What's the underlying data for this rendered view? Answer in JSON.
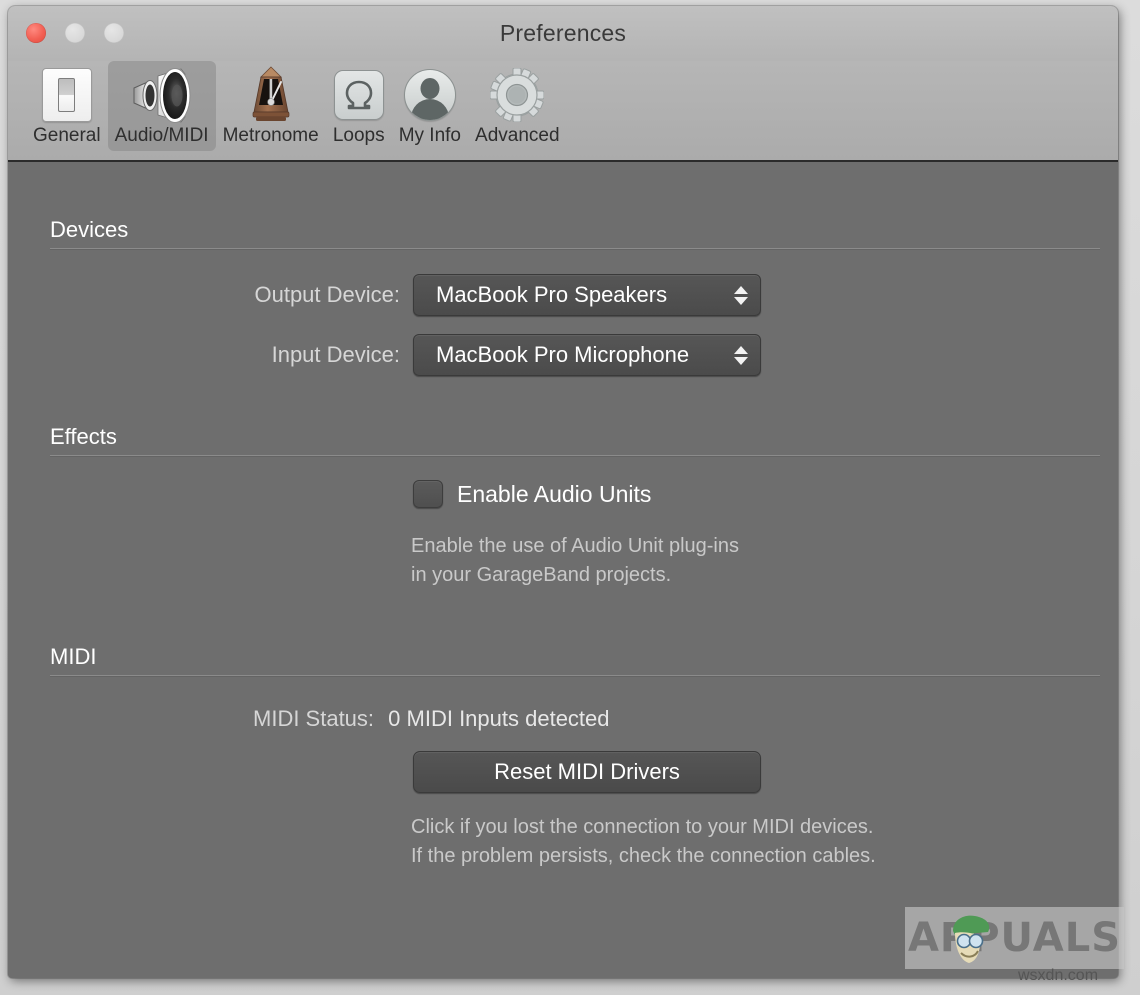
{
  "window": {
    "title": "Preferences",
    "traffic_lights": [
      "close",
      "minimize",
      "zoom"
    ]
  },
  "toolbar": {
    "items": [
      {
        "label": "General",
        "icon": "toggle-switch-icon",
        "selected": false
      },
      {
        "label": "Audio/MIDI",
        "icon": "speaker-icon",
        "selected": true
      },
      {
        "label": "Metronome",
        "icon": "metronome-icon",
        "selected": false
      },
      {
        "label": "Loops",
        "icon": "loops-icon",
        "selected": false
      },
      {
        "label": "My Info",
        "icon": "person-icon",
        "selected": false
      },
      {
        "label": "Advanced",
        "icon": "gear-icon",
        "selected": false
      }
    ]
  },
  "devices": {
    "heading": "Devices",
    "output_label": "Output Device:",
    "output_value": "MacBook Pro Speakers",
    "input_label": "Input Device:",
    "input_value": "MacBook Pro Microphone"
  },
  "effects": {
    "heading": "Effects",
    "checkbox_label": "Enable Audio Units",
    "checked": false,
    "help": "Enable the use of Audio Unit plug-ins\nin your GarageBand projects."
  },
  "midi": {
    "heading": "MIDI",
    "status_label": "MIDI Status:",
    "status_value": "0 MIDI Inputs detected",
    "reset_button": "Reset MIDI Drivers",
    "help": "Click if you lost the connection to your MIDI devices.\nIf the problem persists, check the connection cables."
  },
  "watermark": {
    "brand": "APPUALS",
    "site": "wsxdn.com"
  },
  "colors": {
    "content_bg": "#6e6e6e",
    "toolbar_bg": "#b0b0b0",
    "titlebar_bg": "#bababa",
    "accent_close": "#f25f53",
    "control_bg": "#505050",
    "text_primary": "#ffffff",
    "text_secondary": "#c9c9c9"
  }
}
